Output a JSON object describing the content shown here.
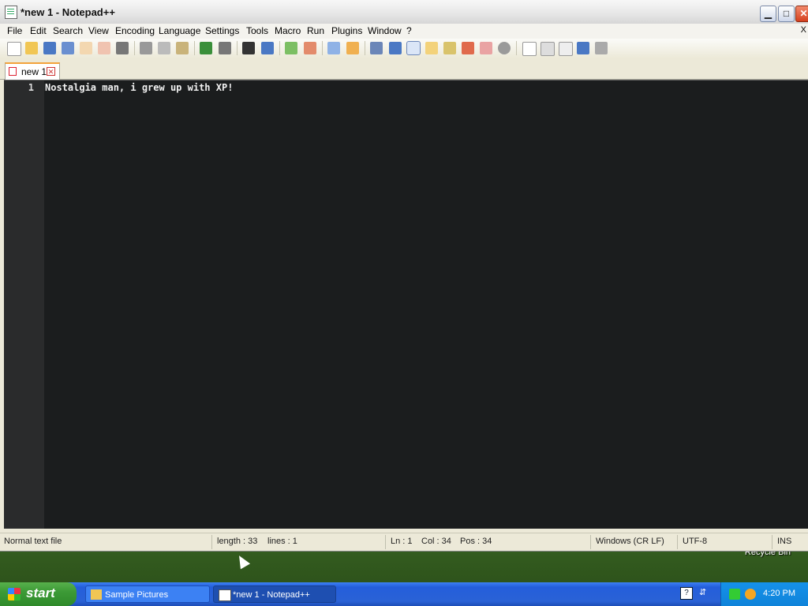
{
  "window": {
    "title": "*new 1 - Notepad++",
    "controls": {
      "minimize": "▁",
      "maximize": "□",
      "close": "✕"
    }
  },
  "menu": {
    "items": [
      "File",
      "Edit",
      "Search",
      "View",
      "Encoding",
      "Language",
      "Settings",
      "Tools",
      "Macro",
      "Run",
      "Plugins",
      "Window",
      "?"
    ],
    "close_doc": "X"
  },
  "toolbar": {
    "icons": [
      "new-file-icon",
      "open-file-icon",
      "save-icon",
      "save-all-icon",
      "close-icon",
      "close-all-icon",
      "print-icon",
      "cut-icon",
      "copy-icon",
      "paste-icon",
      "undo-icon",
      "redo-icon",
      "find-icon",
      "replace-icon",
      "zoom-in-icon",
      "zoom-out-icon",
      "sync-vertical-icon",
      "sync-horizontal-icon",
      "word-wrap-icon",
      "all-characters-icon",
      "indent-guide-icon",
      "function-list-icon",
      "doc-map-icon",
      "folder-workspace-icon",
      "monitoring-icon",
      "spell-icon",
      "record-macro-icon",
      "stop-macro-icon",
      "play-macro-icon",
      "run-macro-multiple-icon",
      "save-macro-icon"
    ]
  },
  "tabs": [
    {
      "label": "new 1"
    }
  ],
  "editor": {
    "lines": [
      {
        "number": "1",
        "text": "Nostalgia man, i grew up with XP!"
      }
    ],
    "colors": {
      "background": "#1b1d1e",
      "gutter": "#2a2b2c",
      "text": "#f2f2f2"
    }
  },
  "status": {
    "file_type": "Normal text file",
    "length": "length : 33",
    "lines": "lines : 1",
    "ln": "Ln : 1",
    "col": "Col : 34",
    "pos": "Pos : 34",
    "eol": "Windows (CR LF)",
    "encoding": "UTF-8",
    "mode": "INS"
  },
  "desktop": {
    "recycle_bin": "Recycle Bin"
  },
  "taskbar": {
    "start": "start",
    "tasks": [
      {
        "label": "Sample Pictures",
        "active": false
      },
      {
        "label": "*new 1 - Notepad++",
        "active": true
      }
    ],
    "help": "?",
    "clock": "4:20 PM"
  }
}
